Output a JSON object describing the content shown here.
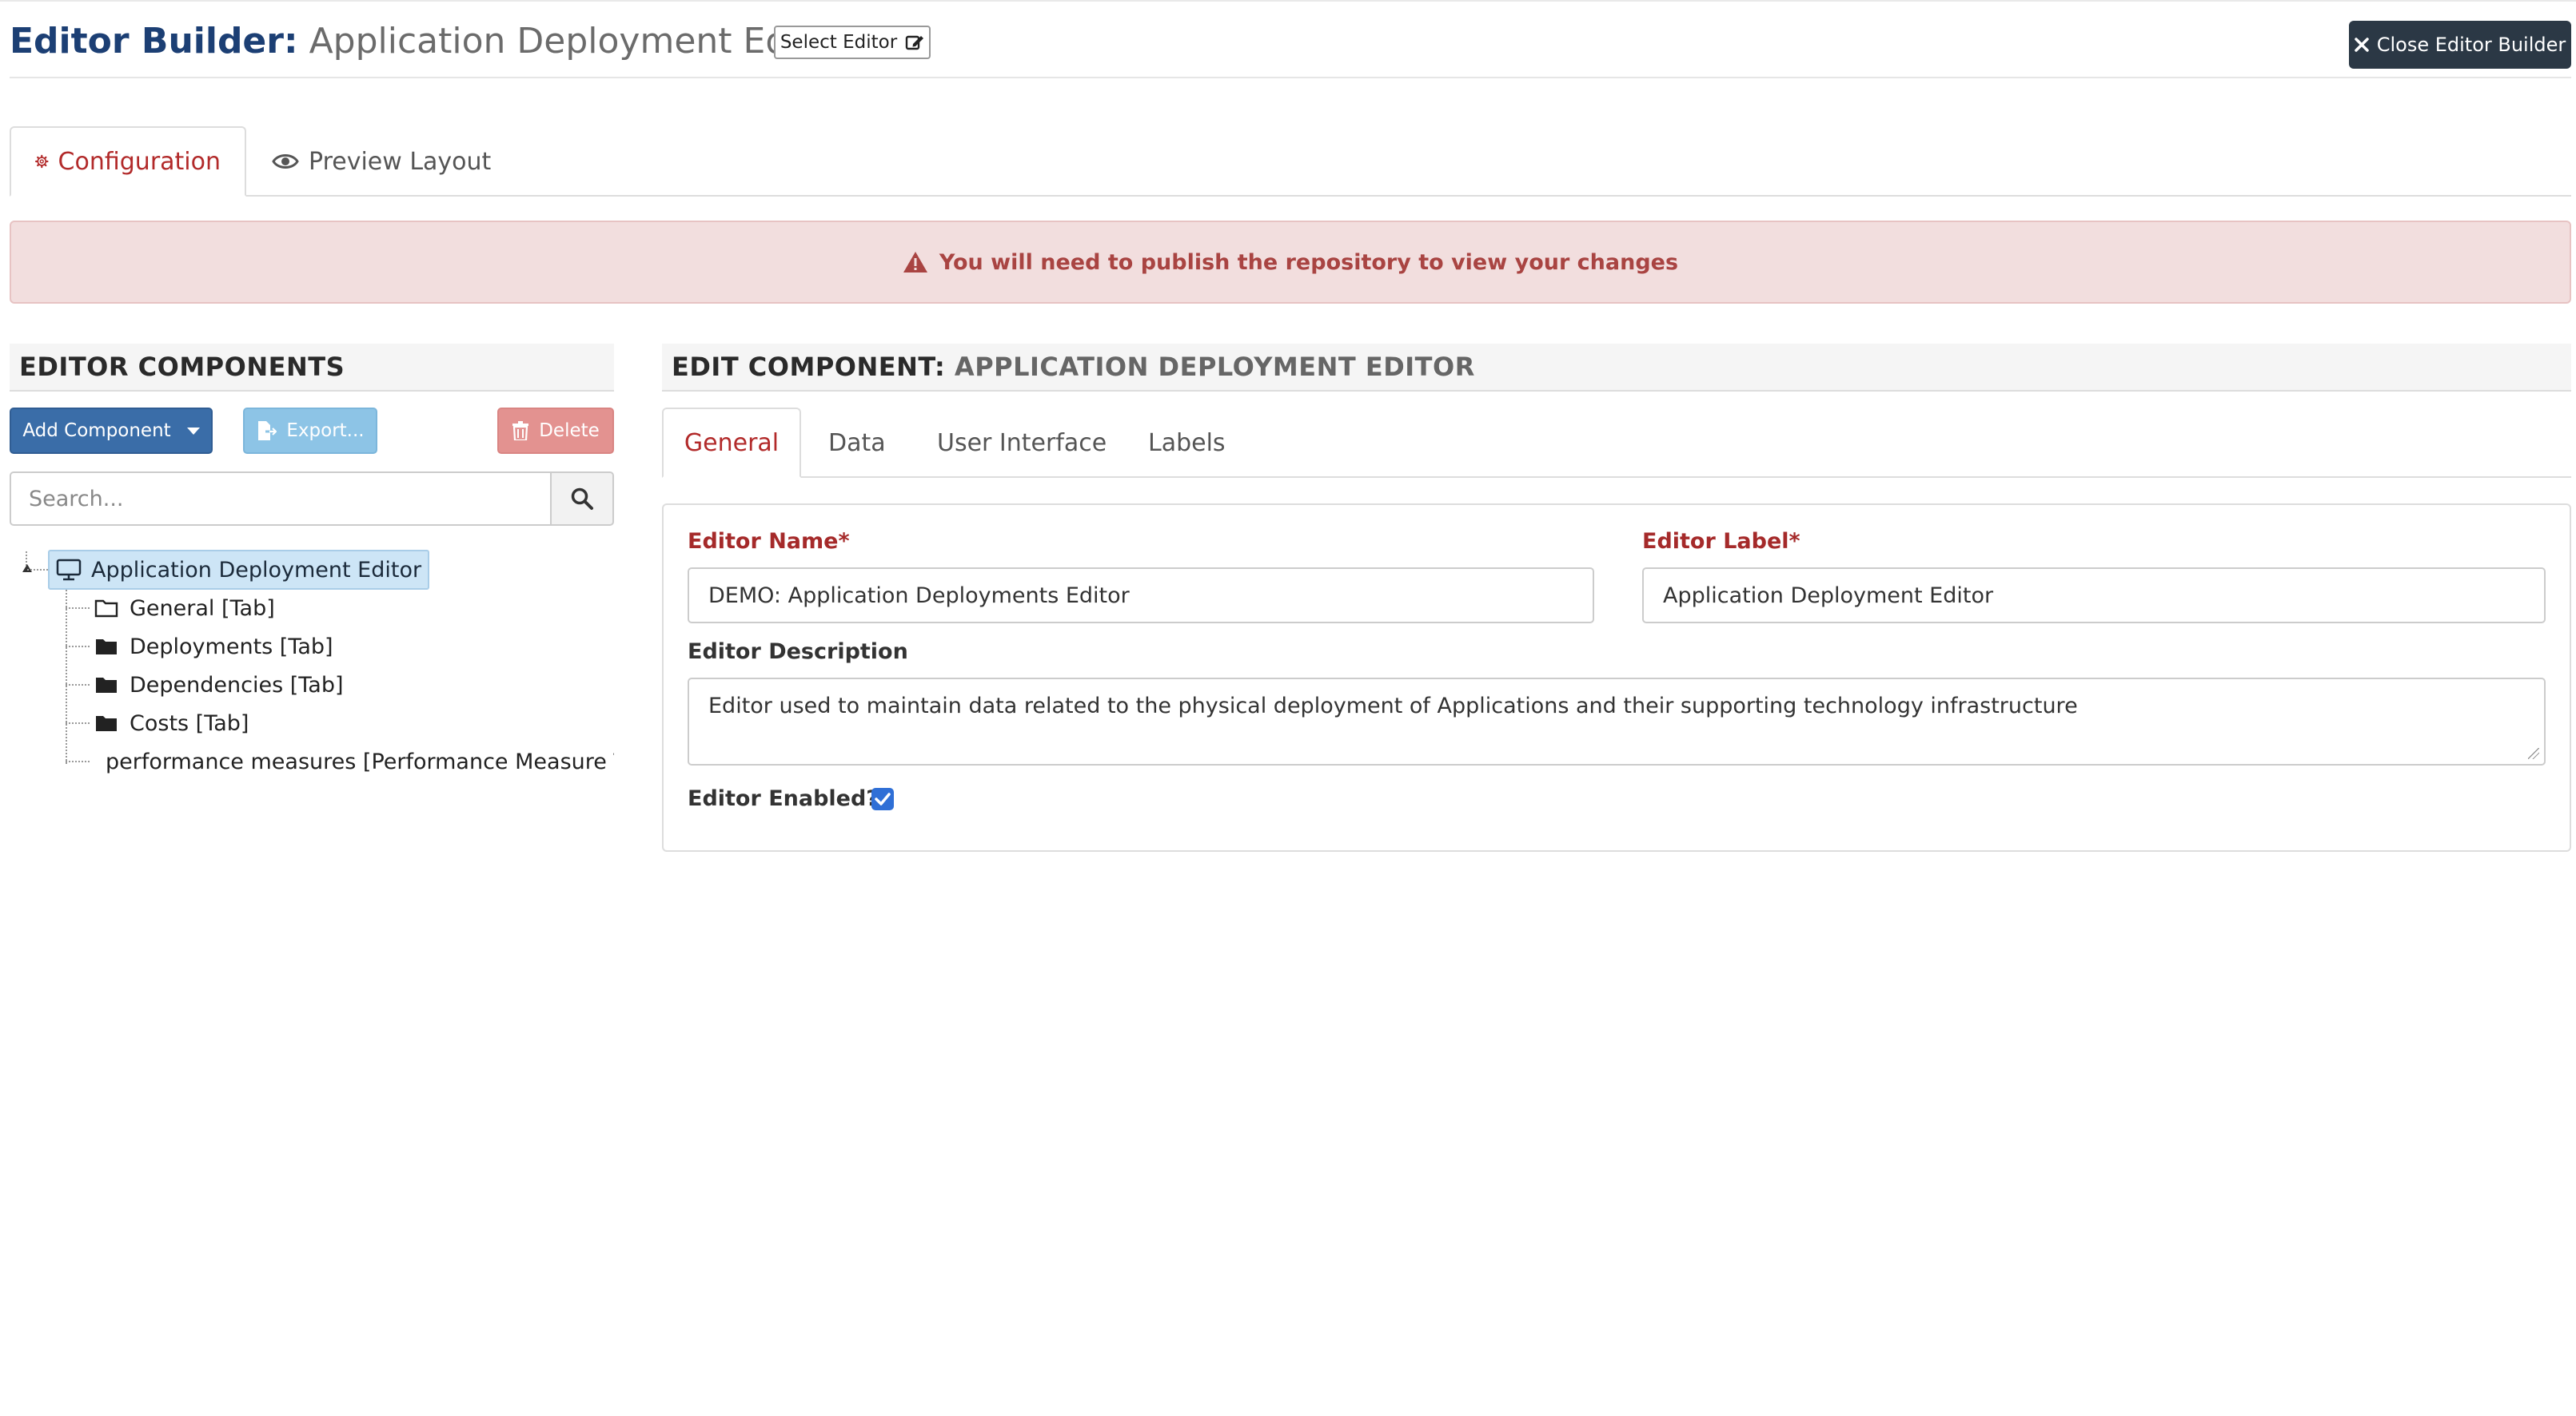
{
  "header": {
    "title_prefix": "Editor Builder:",
    "title_name": "Application Deployment Editor",
    "select_editor_label": "Select Editor",
    "close_label": "Close Editor Builder"
  },
  "main_tabs": [
    {
      "label": "Configuration",
      "active": true
    },
    {
      "label": "Preview Layout",
      "active": false
    }
  ],
  "alert": {
    "text": "You will need to publish the repository to view your changes"
  },
  "left_panel": {
    "title": "EDITOR COMPONENTS",
    "add_label": "Add Component",
    "export_label": "Export...",
    "delete_label": "Delete",
    "search_placeholder": "Search...",
    "tree": {
      "root": "Application Deployment Editor",
      "items": [
        {
          "label": "General [Tab]",
          "icon": "folder-open-icon"
        },
        {
          "label": "Deployments [Tab]",
          "icon": "folder-icon"
        },
        {
          "label": "Dependencies [Tab]",
          "icon": "folder-icon"
        },
        {
          "label": "Costs [Tab]",
          "icon": "folder-icon"
        },
        {
          "label": "performance measures [Performance Measure Ta",
          "icon": "folder-icon"
        }
      ]
    }
  },
  "right_panel": {
    "title_prefix": "EDIT COMPONENT:",
    "title_name": "APPLICATION DEPLOYMENT EDITOR",
    "tabs": [
      {
        "label": "General",
        "active": true
      },
      {
        "label": "Data",
        "active": false
      },
      {
        "label": "User Interface",
        "active": false
      },
      {
        "label": "Labels",
        "active": false
      }
    ],
    "form": {
      "name_label": "Editor Name*",
      "name_value": "DEMO: Application Deployments Editor",
      "label_label": "Editor Label*",
      "label_value": "Application Deployment Editor",
      "description_label": "Editor Description",
      "description_value": "Editor used to maintain data related to the physical deployment of Applications and their supporting technology infrastructure",
      "enabled_label": "Editor Enabled?",
      "enabled": true
    }
  },
  "colors": {
    "brand_title": "#1c3f74",
    "active_tab": "#b22a2a",
    "alert_bg": "#f2dede",
    "alert_text": "#a94442",
    "add_button": "#3a6da8",
    "export_button": "#8dc4e6",
    "delete_button": "#e39290",
    "close_button": "#2b3845"
  }
}
